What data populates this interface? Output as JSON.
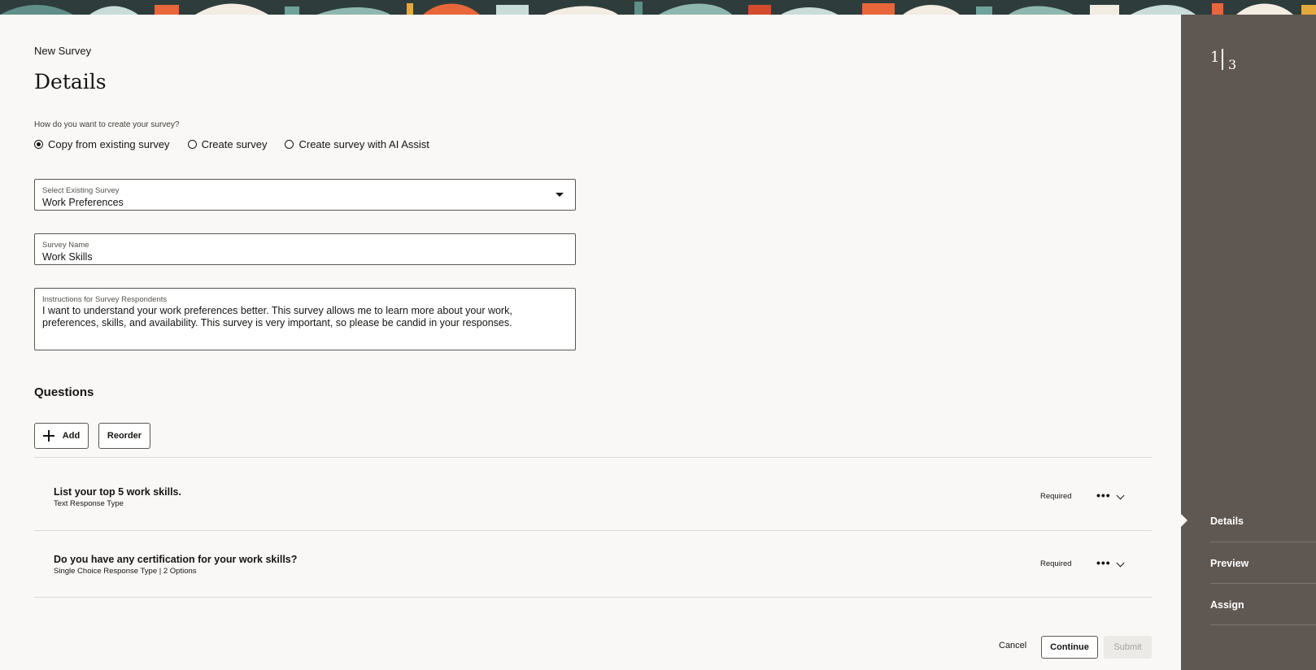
{
  "header": {
    "pre_title": "New Survey",
    "title": "Details"
  },
  "creation_method": {
    "question": "How do you want to create your survey?",
    "options": [
      {
        "label": "Copy from existing survey",
        "selected": true
      },
      {
        "label": "Create survey",
        "selected": false
      },
      {
        "label": "Create survey with AI Assist",
        "selected": false
      }
    ]
  },
  "fields": {
    "existing_survey": {
      "label": "Select Existing Survey",
      "value": "Work Preferences"
    },
    "survey_name": {
      "label": "Survey Name",
      "value": "Work Skills"
    },
    "instructions": {
      "label": "Instructions for Survey Respondents",
      "value": "I want to understand your work preferences better. This survey allows me to learn more about your work, preferences, skills, and availability. This survey is very important, so please be candid in your responses."
    }
  },
  "questions": {
    "heading": "Questions",
    "add_label": "Add",
    "reorder_label": "Reorder",
    "items": [
      {
        "title": "List your top 5 work skills.",
        "subtitle": "Text Response Type",
        "required": "Required",
        "more": "•••"
      },
      {
        "title": "Do you have any certification for your work skills?",
        "subtitle": "Single Choice Response Type | 2 Options",
        "required": "Required",
        "more": "•••"
      }
    ]
  },
  "footer": {
    "cancel": "Cancel",
    "continue": "Continue",
    "submit": "Submit"
  },
  "train": {
    "current": "1",
    "total": "3",
    "steps": [
      "Details",
      "Preview",
      "Assign"
    ]
  },
  "colors": {
    "background": "#f9f8f6",
    "train_panel": "#5f5752",
    "text": "#161513"
  },
  "icons": {
    "add": "plus-icon",
    "dropdown": "caret-down-icon",
    "more": "more-horizontal-icon",
    "expand": "chevron-down-icon",
    "current_step": "step-pointer-icon"
  }
}
